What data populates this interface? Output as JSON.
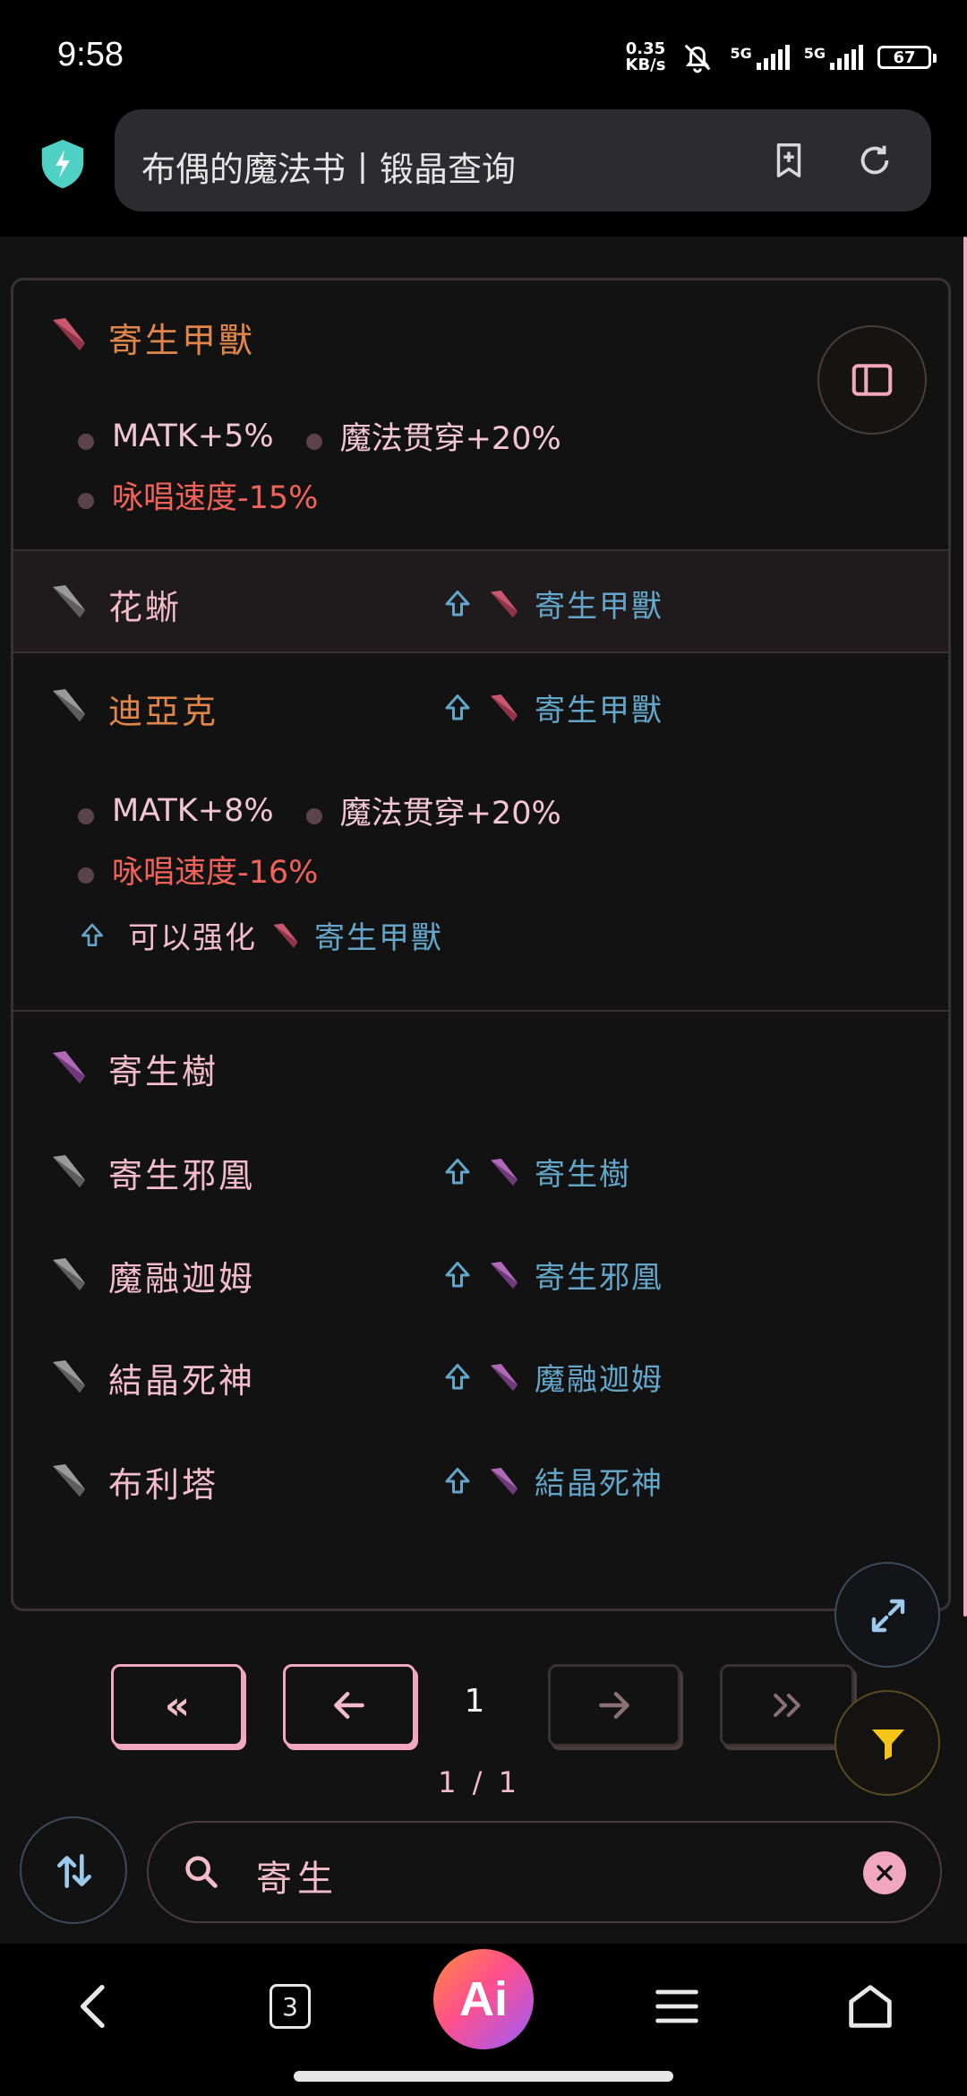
{
  "status_bar": {
    "time": "9:58",
    "net_speed_top": "0.35",
    "net_speed_bottom": "KB/s",
    "sig1_label": "5G",
    "sig2_label": "5G",
    "battery": "67"
  },
  "browser": {
    "url_title": "布偶的魔法书丨锻晶查询"
  },
  "list": {
    "items": [
      {
        "name": "寄生甲獸",
        "name_color": "#e0864a",
        "gem_color": "#c9586e",
        "stats_line1": [
          "MATK+5%",
          "魔法贯穿+20%"
        ],
        "stats_line2": [
          "咏唱速度-15%"
        ]
      },
      {
        "name": "花蜥",
        "name_color": "#f2bccd",
        "gem_color": "#8a8a8a",
        "upgrade_to": "寄生甲獸",
        "upgrade_gem_color": "#c9586e"
      },
      {
        "name": "迪亞克",
        "name_color": "#e0864a",
        "gem_color": "#8a8a8a",
        "upgrade_to": "寄生甲獸",
        "upgrade_gem_color": "#c9586e",
        "stats_line1": [
          "MATK+8%",
          "魔法贯穿+20%"
        ],
        "stats_line2": [
          "咏唱速度-16%"
        ],
        "can_enhance_label": "可以强化",
        "can_enhance_target": "寄生甲獸"
      },
      {
        "name": "寄生樹",
        "name_color": "#f2bccd",
        "gem_color": "#a85ab0"
      },
      {
        "name": "寄生邪凰",
        "name_color": "#f2bccd",
        "gem_color": "#8a8a8a",
        "upgrade_to": "寄生樹",
        "upgrade_gem_color": "#a85ab0"
      },
      {
        "name": "魔融迦姆",
        "name_color": "#f2bccd",
        "gem_color": "#8a8a8a",
        "upgrade_to": "寄生邪凰",
        "upgrade_gem_color": "#a85ab0"
      },
      {
        "name": "結晶死神",
        "name_color": "#f2bccd",
        "gem_color": "#8a8a8a",
        "upgrade_to": "魔融迦姆",
        "upgrade_gem_color": "#a85ab0"
      },
      {
        "name": "布利塔",
        "name_color": "#f2bccd",
        "gem_color": "#8a8a8a",
        "upgrade_to": "結晶死神",
        "upgrade_gem_color": "#a85ab0"
      }
    ]
  },
  "pager": {
    "first": "«",
    "current_page": "1",
    "page_count": "1 / 1"
  },
  "search": {
    "value": "寄生"
  },
  "nav": {
    "tabs_count": "3",
    "ai_label": "Ai"
  },
  "icons": [
    "shield-icon",
    "add-bookmark-icon",
    "refresh-icon",
    "sidebar-panel-icon",
    "expand-icon",
    "filter-icon",
    "sort-icon",
    "search-icon",
    "clear-icon",
    "back-icon",
    "tabs-icon",
    "menu-icon",
    "home-icon"
  ],
  "colors": {
    "accent_pink": "#f2a7c0",
    "link_blue": "#63a6c9",
    "negative_red": "#f0625a",
    "orange_name": "#e0864a"
  }
}
